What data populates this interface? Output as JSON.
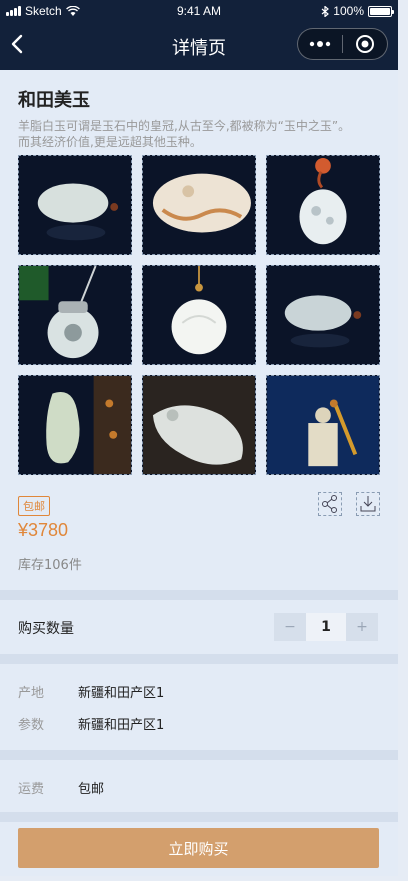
{
  "status_bar": {
    "carrier": "Sketch",
    "time": "9:41 AM",
    "battery": "100%"
  },
  "nav": {
    "title": "详情页"
  },
  "product": {
    "title": "和田美玉",
    "description": "羊脂白玉可谓是玉石中的皇冠,从古至今,都被称为“玉中之玉”。而其经济价值,更是远超其他玉种。",
    "badge": "包邮",
    "price": "¥3780",
    "stock": "库存106件",
    "photos": [
      {
        "name": "jade-pendant-1",
        "color": "#cfd8d4"
      },
      {
        "name": "jade-pendant-2",
        "color": "#e8dccb"
      },
      {
        "name": "jade-pendant-3",
        "color": "#dfe6e9"
      },
      {
        "name": "jade-pendant-4",
        "color": "#d7dfe0"
      },
      {
        "name": "jade-pendant-5",
        "color": "#eef1ee"
      },
      {
        "name": "jade-pendant-6",
        "color": "#c8d3d6"
      },
      {
        "name": "jade-pendant-7",
        "color": "#c9d9c0"
      },
      {
        "name": "jade-pendant-8",
        "color": "#d8dcd8"
      },
      {
        "name": "jade-seal-9",
        "color": "#d9d6c9"
      }
    ]
  },
  "quantity": {
    "label": "购买数量",
    "minus": "−",
    "value": "1",
    "plus": "+"
  },
  "specs": [
    {
      "key": "产地",
      "value": "新疆和田产区1"
    },
    {
      "key": "参数",
      "value": "新疆和田产区1"
    }
  ],
  "shipping": {
    "key": "运费",
    "value": "包邮"
  },
  "buy_button": "立即购买",
  "colors": {
    "accent": "#e0873a",
    "button": "#d39f6d",
    "header": "#12213a"
  }
}
